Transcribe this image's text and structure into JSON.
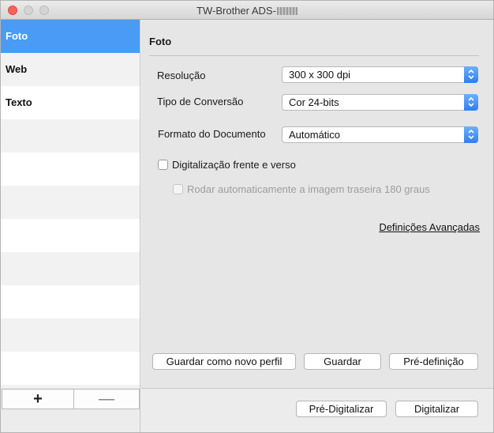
{
  "window": {
    "title": "TW-Brother ADS-"
  },
  "sidebar": {
    "profiles": [
      {
        "label": "Foto",
        "selected": true
      },
      {
        "label": "Web",
        "selected": false
      },
      {
        "label": "Texto",
        "selected": false
      }
    ],
    "add_label": "+",
    "remove_label": "—"
  },
  "main": {
    "section_title": "Foto",
    "resolution": {
      "label": "Resolução",
      "value": "300 x 300 dpi"
    },
    "conversion": {
      "label": "Tipo de Conversão",
      "value": "Cor 24-bits"
    },
    "document_format": {
      "label": "Formato do Documento",
      "value": "Automático"
    },
    "duplex": {
      "label": "Digitalização frente e verso",
      "checked": false
    },
    "rotate_back": {
      "label": "Rodar automaticamente a imagem traseira 180 graus",
      "checked": false,
      "enabled": false
    },
    "advanced_link": "Definições Avançadas",
    "buttons": {
      "save_new": "Guardar como novo perfil",
      "save": "Guardar",
      "default": "Pré-definição"
    }
  },
  "footer": {
    "prescan": "Pré-Digitalizar",
    "scan": "Digitalizar"
  },
  "colors": {
    "selection": "#4a9bf5",
    "popup_arrow": "#2d7ef1",
    "close": "#fc605c"
  }
}
